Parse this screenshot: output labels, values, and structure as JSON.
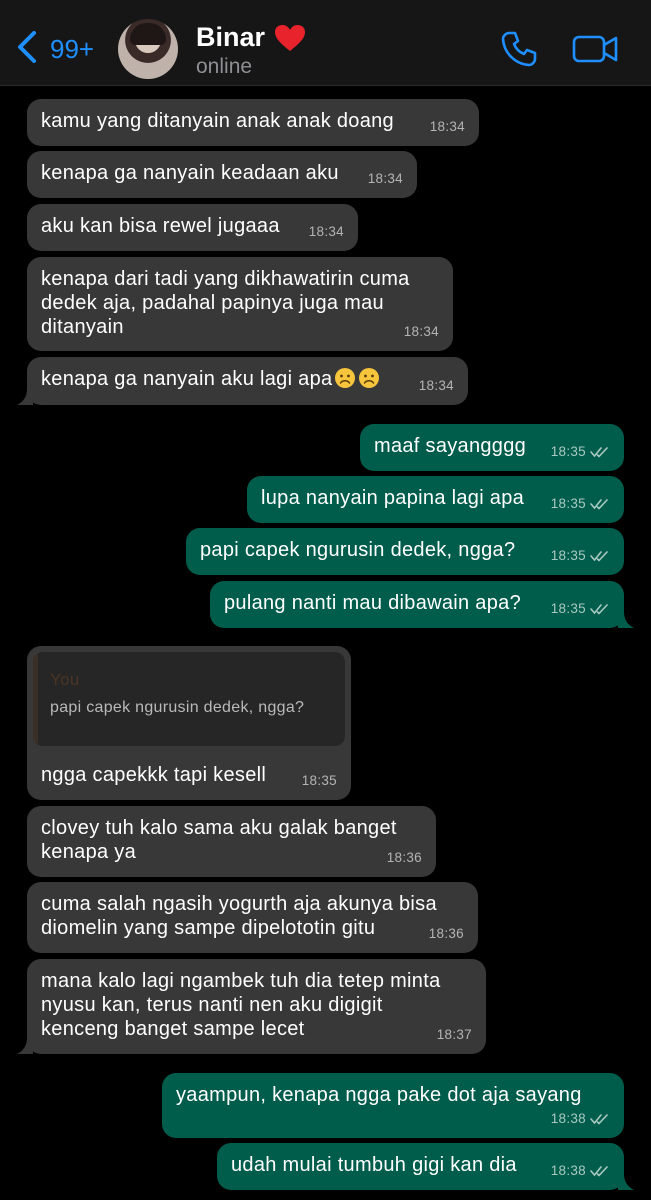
{
  "header": {
    "back_count": "99+",
    "contact_name": "Binar",
    "status": "online",
    "accent_color": "#1f8fff"
  },
  "messages": [
    {
      "dir": "in",
      "text": "kamu yang ditanyain anak anak doang",
      "time": "18:34"
    },
    {
      "dir": "in",
      "text": "kenapa ga nanyain keadaan aku",
      "time": "18:34"
    },
    {
      "dir": "in",
      "text": "aku kan bisa rewel jugaaa",
      "time": "18:34"
    },
    {
      "dir": "in",
      "text": "kenapa dari tadi yang dikhawatirin cuma\ndedek aja, padahal papinya juga mau\nditanyain",
      "time": "18:34"
    },
    {
      "dir": "in",
      "text": "kenapa ga nanyain aku lagi apa",
      "emojis": [
        "frowning-face",
        "frowning-face"
      ],
      "time": "18:34"
    },
    {
      "dir": "out",
      "text": "maaf sayangggg",
      "time": "18:35",
      "read": true
    },
    {
      "dir": "out",
      "text": "lupa nanyain papina lagi apa",
      "time": "18:35",
      "read": true
    },
    {
      "dir": "out",
      "text": "papi capek ngurusin dedek, ngga?",
      "time": "18:35",
      "read": true
    },
    {
      "dir": "out",
      "text": "pulang nanti mau dibawain apa?",
      "time": "18:35",
      "read": true
    },
    {
      "dir": "in",
      "reply_to": {
        "author": "You",
        "text": "papi capek ngurusin dedek, ngga?"
      },
      "text": "ngga capekkk tapi kesell",
      "time": "18:35"
    },
    {
      "dir": "in",
      "text": "clovey tuh kalo sama aku galak banget\nkenapa ya",
      "time": "18:36"
    },
    {
      "dir": "in",
      "text": "cuma salah ngasih yogurth aja akunya bisa\ndiomelin yang sampe dipelototin gitu",
      "time": "18:36"
    },
    {
      "dir": "in",
      "text": "mana kalo lagi ngambek tuh dia tetep minta\nnyusu kan, terus nanti nen aku digigit\nkenceng banget sampe lecet",
      "time": "18:37"
    },
    {
      "dir": "out",
      "text": "yaampun, kenapa ngga pake dot aja sayang",
      "time": "18:38",
      "read": true
    },
    {
      "dir": "out",
      "text": "udah mulai tumbuh gigi kan dia",
      "time": "18:38",
      "read": true
    }
  ]
}
